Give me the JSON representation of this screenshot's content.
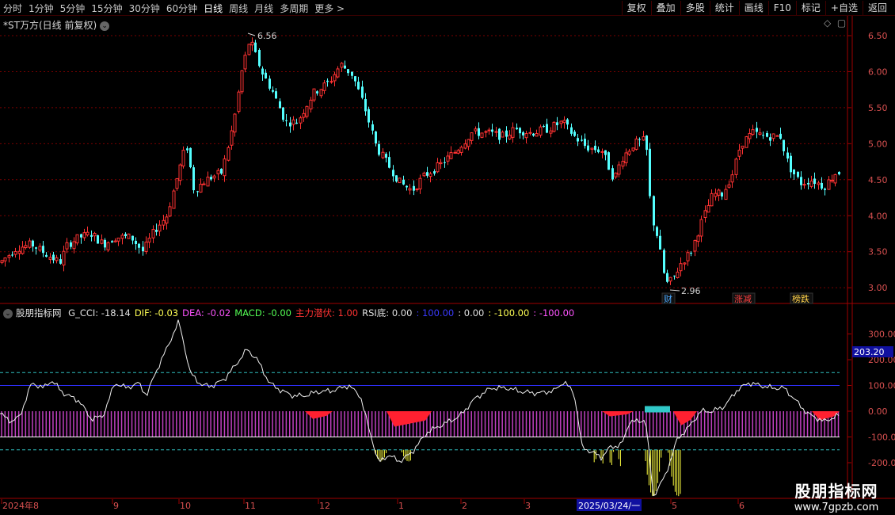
{
  "toolbar": {
    "periods": [
      "分时",
      "1分钟",
      "5分钟",
      "15分钟",
      "30分钟",
      "60分钟",
      "日线",
      "周线",
      "月线",
      "多周期",
      "更多 >"
    ],
    "active_period": "日线",
    "buttons": [
      "复权",
      "叠加",
      "多股",
      "统计",
      "画线",
      "F10",
      "标记",
      "+自选",
      "返回"
    ]
  },
  "main_chart": {
    "title": "*ST万方(日线 前复权)",
    "icons": [
      "diamond-icon",
      "square-icon"
    ],
    "price_axis_ticks": [
      "6.50",
      "6.00",
      "5.50",
      "5.00",
      "4.50",
      "4.00",
      "3.50",
      "3.00"
    ],
    "high_label": "6.56",
    "low_label": "2.96",
    "event_badges": [
      {
        "label": "财",
        "color": "#4aa8ff"
      },
      {
        "label": "涨减",
        "color": "#ff4040"
      },
      {
        "label": "榜跌",
        "color": "#ffd24a"
      }
    ],
    "colors": {
      "up": "#ff3232",
      "down": "#54ffff",
      "grid": "#7a0000"
    }
  },
  "indicator": {
    "name": "股朋指标网",
    "values": [
      {
        "text": "G_CCI: -18.14",
        "color": "#e0e0e0"
      },
      {
        "text": "DIF: -0.03",
        "color": "#ffff54"
      },
      {
        "text": "DEA: -0.02",
        "color": "#ff54ff"
      },
      {
        "text": "MACD: -0.00",
        "color": "#54ff54"
      },
      {
        "text": "主力潜伏: 1.00",
        "color": "#ff3232"
      },
      {
        "text": "RSI底: 0.00",
        "color": "#e0e0e0"
      },
      {
        "text": ": 100.00",
        "color": "#3a3aff"
      },
      {
        "text": ": 0.00",
        "color": "#e0e0e0"
      },
      {
        "text": ": -100.00",
        "color": "#ffff54"
      },
      {
        "text": ": -100.00",
        "color": "#ff54ff"
      }
    ],
    "axis_ticks": [
      "300.00",
      "200.00",
      "100.00",
      "0.00",
      "-100.00",
      "-200.00"
    ],
    "current_value_box": "203.20"
  },
  "time_axis": {
    "labels": [
      "2024年8",
      "9",
      "10",
      "11",
      "12",
      "1",
      "2",
      "3",
      "2025/03/24/一",
      "5",
      "6"
    ]
  },
  "watermark": {
    "title": "股朋指标网",
    "url": "www.7gpzb.com"
  }
}
